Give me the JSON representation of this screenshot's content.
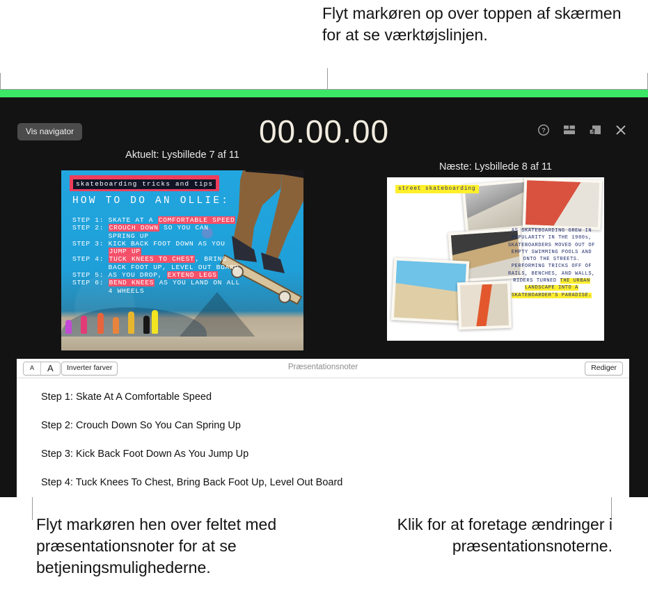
{
  "callouts": {
    "top": "Flyt markøren op over toppen af skærmen for at se værktøjslinjen.",
    "bottom_left": "Flyt markøren hen over feltet med præsentationsnoter for at se betjeningsmulighederne.",
    "bottom_right": "Klik for at foretage ændringer i præsentationsnoterne."
  },
  "presenter": {
    "accent_bar_color": "#3ce667",
    "background_color": "#131313",
    "show_navigator_label": "Vis navigator",
    "timer": "00.00.00",
    "toolbar_icons": [
      {
        "name": "help-icon",
        "glyph": "?"
      },
      {
        "name": "layout-icon",
        "glyph": "▤"
      },
      {
        "name": "swap-layout-icon",
        "glyph": "⧉"
      },
      {
        "name": "close-icon",
        "glyph": "✕"
      }
    ]
  },
  "slides": {
    "current_label": "Aktuelt: Lysbillede 7 af 11",
    "next_label": "Næste: Lysbillede 8 af 11",
    "current": {
      "title": "skateboarding tricks and tips",
      "heading": "HOW TO DO AN OLLIE:",
      "steps": [
        {
          "plain_before": "STEP 1: SKATE AT A ",
          "highlight": "COMFORTABLE SPEED",
          "plain_after": ""
        },
        {
          "plain_before": "STEP 2: ",
          "highlight": "CROUCH DOWN",
          "plain_after": " SO YOU CAN"
        },
        {
          "plain_before": "        SPRING UP",
          "highlight": "",
          "plain_after": ""
        },
        {
          "plain_before": "STEP 3: KICK BACK FOOT DOWN AS YOU",
          "highlight": "",
          "plain_after": ""
        },
        {
          "plain_before": "        ",
          "highlight": "JUMP UP",
          "plain_after": ""
        },
        {
          "plain_before": "STEP 4: ",
          "highlight": "TUCK KNEES TO CHEST",
          "plain_after": ", BRING"
        },
        {
          "plain_before": "        BACK FOOT UP, LEVEL OUT BOARD",
          "highlight": "",
          "plain_after": ""
        },
        {
          "plain_before": "STEP 5: AS YOU DROP, ",
          "highlight": "EXTEND LEGS",
          "plain_after": ""
        },
        {
          "plain_before": "STEP 6: ",
          "highlight": "BEND KNEES",
          "plain_after": " AS YOU LAND ON ALL"
        },
        {
          "plain_before": "        4 WHEELS",
          "highlight": "",
          "plain_after": ""
        }
      ]
    },
    "next": {
      "title": "street skateboarding",
      "body_plain": "AS SKATEBOARDING GREW IN POPULARITY IN THE 1980s, SKATEBOARDERS MOVED OUT OF EMPTY SWIMMING POOLS AND ONTO THE STREETS. PERFORMING TRICKS OFF OF RAILS, BENCHES, AND WALLS, RIDERS TURNED ",
      "body_highlight": "THE URBAN LANDSCAPE INTO A SKATEBOARDER'S PARADISE."
    }
  },
  "notes": {
    "title": "Præsentationsnoter",
    "font_small_label": "A",
    "font_large_label": "A",
    "invert_label": "Inverter farver",
    "edit_label": "Rediger",
    "lines": [
      "Step 1: Skate At A Comfortable Speed",
      "Step 2: Crouch Down So You Can Spring Up",
      "Step 3: Kick Back Foot Down As You Jump Up",
      "Step 4: Tuck Knees To Chest, Bring Back Foot Up, Level Out Board"
    ]
  }
}
